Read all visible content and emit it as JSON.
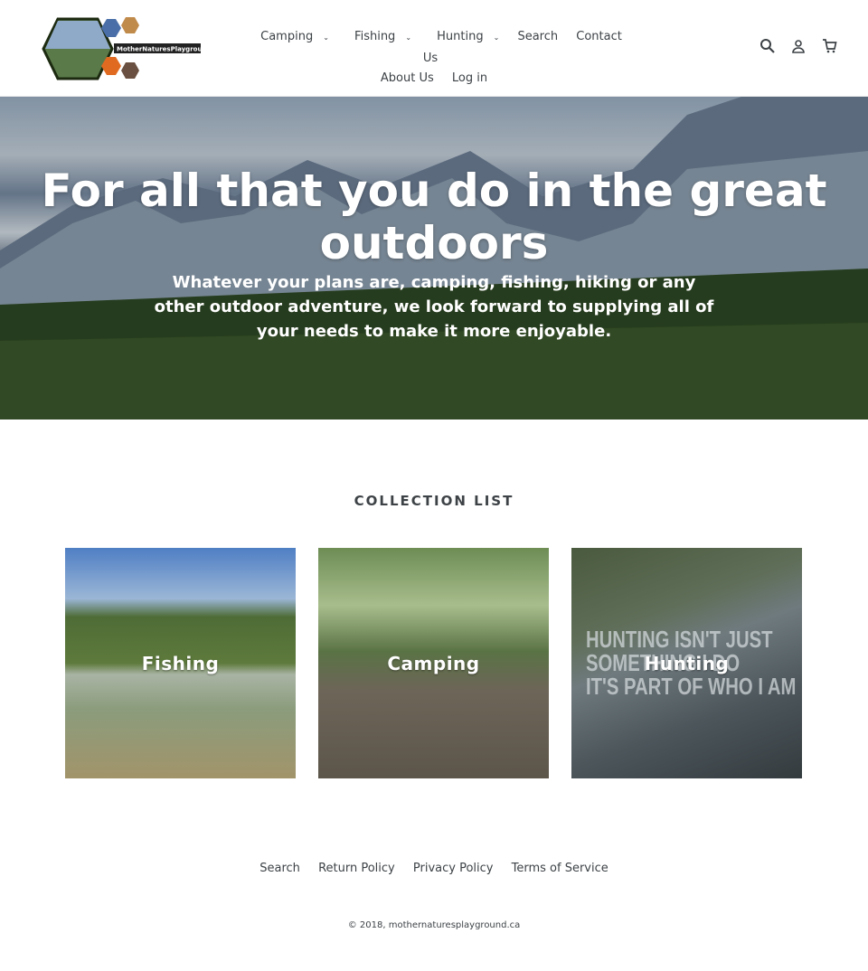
{
  "header": {
    "logo_text": "MotherNaturesPlayground.CA",
    "nav": [
      {
        "label": "Camping",
        "dropdown": true
      },
      {
        "label": "Fishing",
        "dropdown": true
      },
      {
        "label": "Hunting",
        "dropdown": true
      },
      {
        "label": "Search"
      },
      {
        "label": "Contact Us"
      }
    ],
    "nav2": [
      {
        "label": "About Us"
      },
      {
        "label": "Log in"
      }
    ],
    "icons": [
      "search-icon",
      "account-icon",
      "cart-icon"
    ]
  },
  "hero": {
    "title": "For all that you do in the great outdoors",
    "text": "Whatever your plans are, camping, fishing, hiking or any other outdoor adventure, we look forward to supplying all of your needs to make it more enjoyable."
  },
  "collections": {
    "title": "COLLECTION LIST",
    "items": [
      {
        "label": "Fishing"
      },
      {
        "label": "Camping"
      },
      {
        "label": "Hunting",
        "image_text": [
          "HUNTING ISN'T JUST",
          "SOMETHING I DO",
          "IT'S PART OF WHO I AM"
        ]
      }
    ]
  },
  "footer": {
    "links": [
      "Search",
      "Return Policy",
      "Privacy Policy",
      "Terms of Service"
    ],
    "copyright": "© 2018, mothernaturesplayground.ca"
  }
}
